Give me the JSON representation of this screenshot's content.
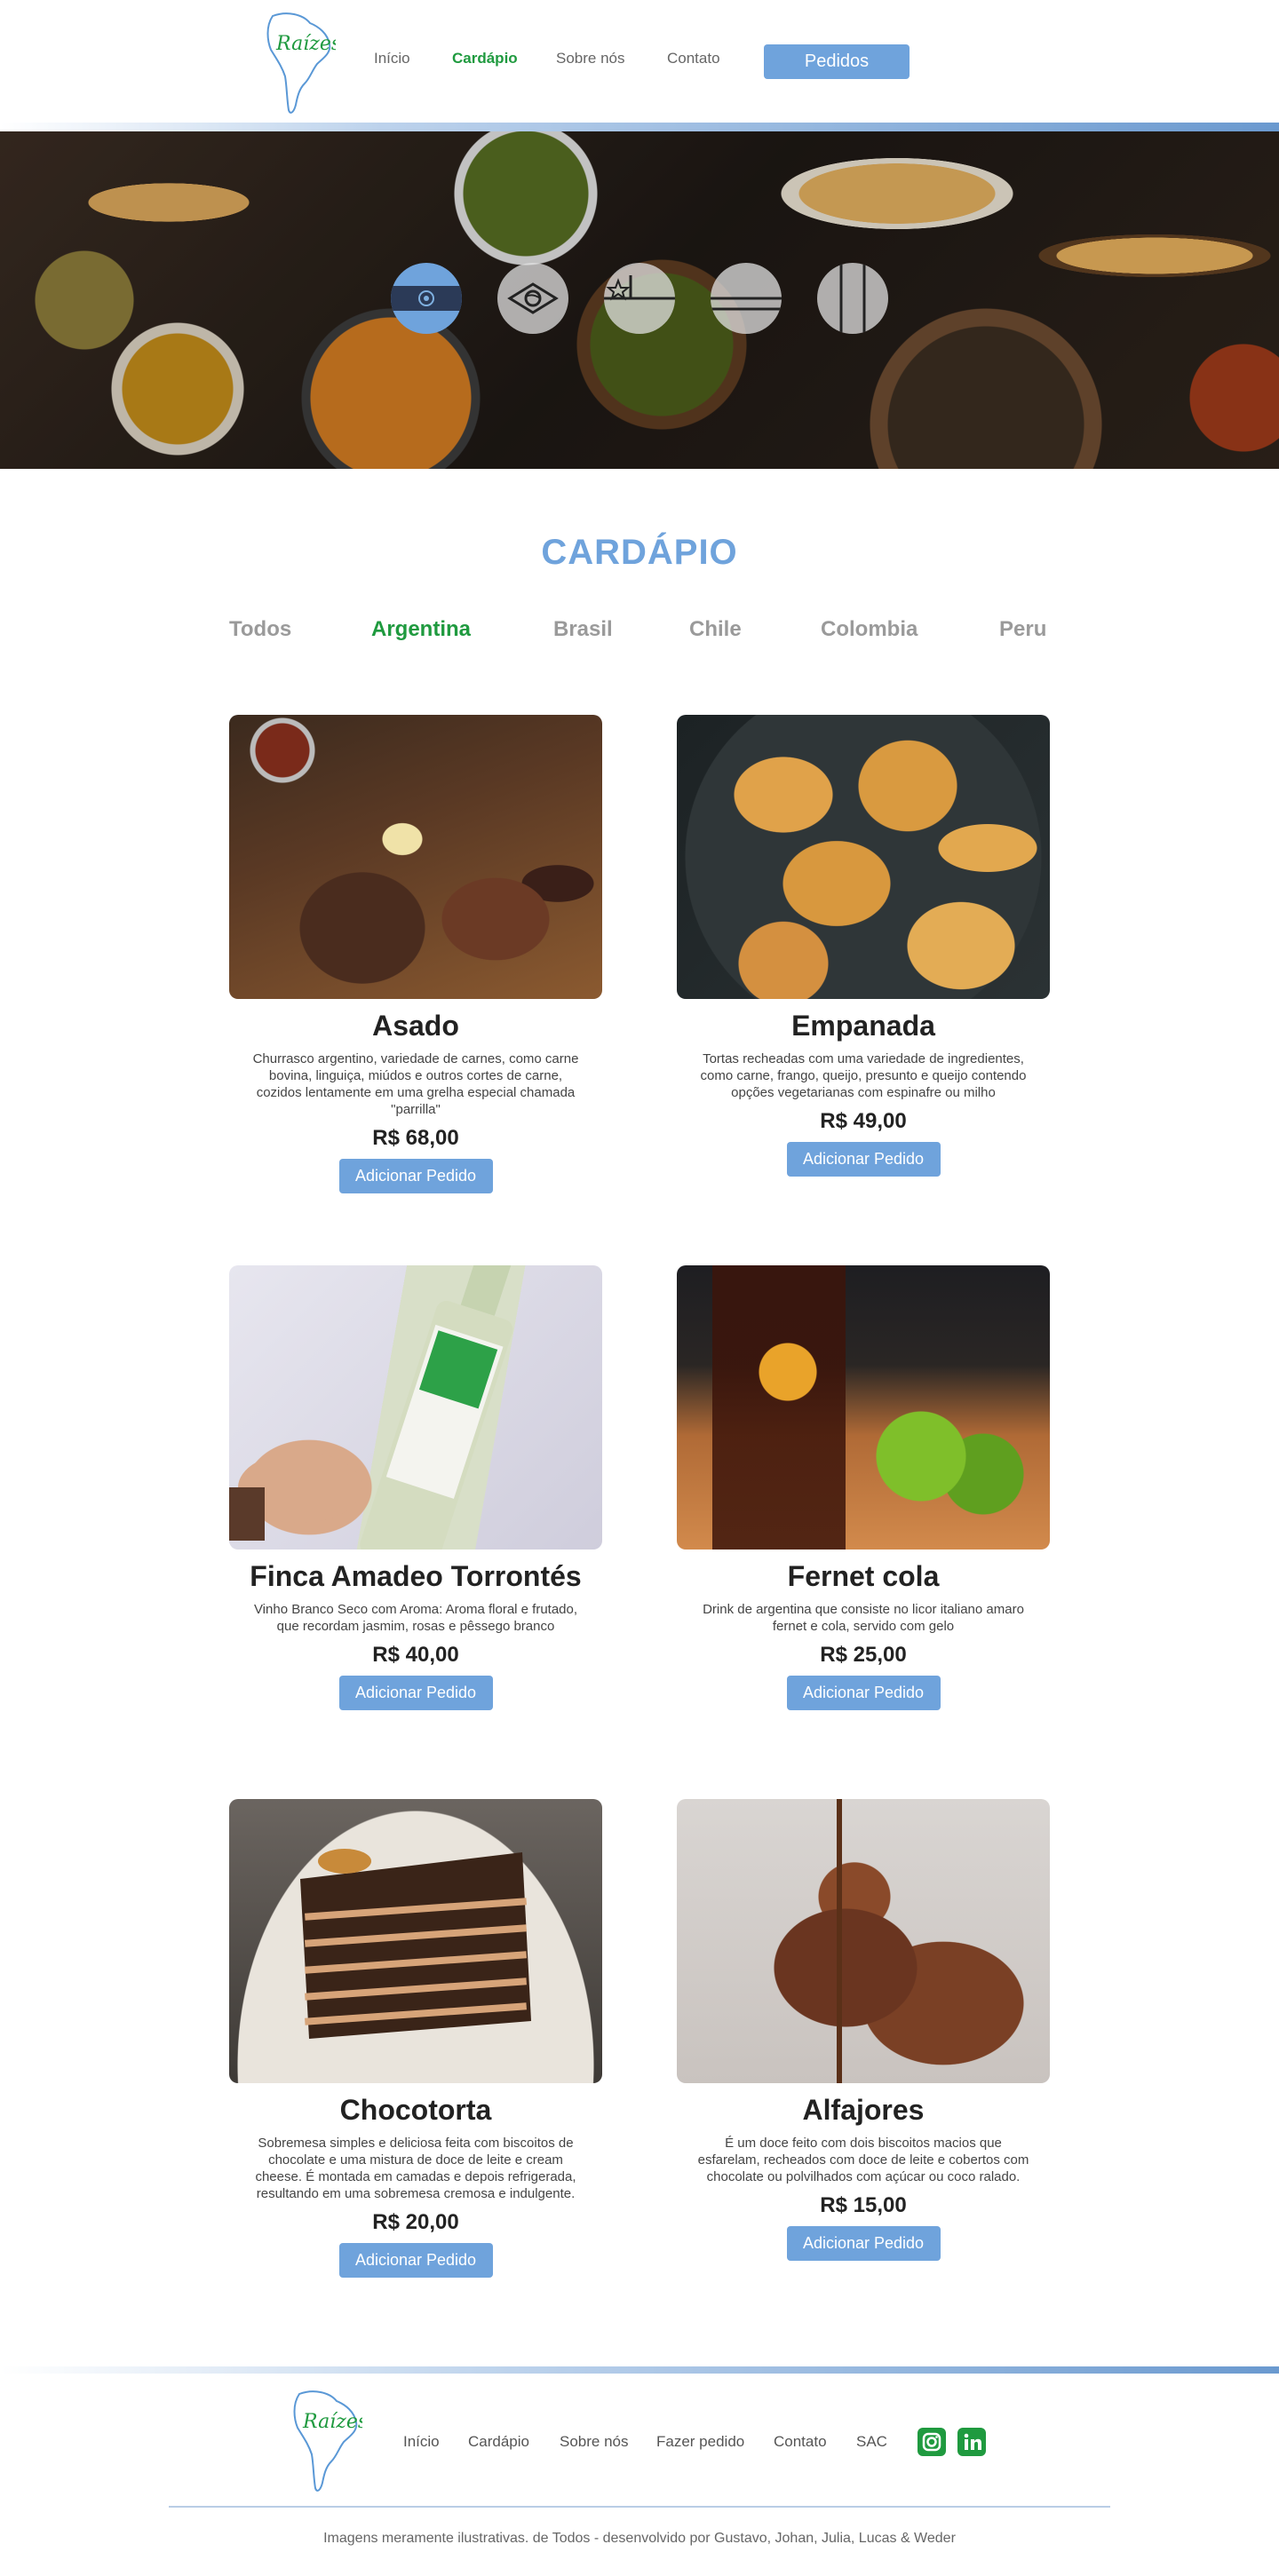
{
  "header": {
    "logo_text": "Raízes",
    "nav": [
      "Início",
      "Cardápio",
      "Sobre nós",
      "Contato"
    ],
    "active_nav": "Cardápio",
    "orders_label": "Pedidos"
  },
  "hero": {
    "flags": [
      "argentina",
      "brasil",
      "chile",
      "colombia",
      "peru"
    ],
    "active_flag": "argentina"
  },
  "menu": {
    "title": "CARDÁPIO",
    "tabs": [
      "Todos",
      "Argentina",
      "Brasil",
      "Chile",
      "Colombia",
      "Peru"
    ],
    "active_tab": "Argentina",
    "items": [
      {
        "name": "Asado",
        "description": "Churrasco argentino, variedade de carnes, como carne bovina, linguiça, miúdos e outros cortes de carne, cozidos lentamente em uma grelha especial chamada \"parrilla\"",
        "price": "R$ 68,00",
        "button": "Adicionar Pedido"
      },
      {
        "name": "Empanada",
        "description": "Tortas recheadas com uma variedade de ingredientes, como carne, frango, queijo, presunto e queijo contendo opções vegetarianas com espinafre ou milho",
        "price": "R$ 49,00",
        "button": "Adicionar Pedido"
      },
      {
        "name": "Finca Amadeo Torrontés",
        "description": "Vinho Branco Seco com Aroma: Aroma floral e frutado, que recordam jasmim, rosas e pêssego branco",
        "price": "R$ 40,00",
        "button": "Adicionar Pedido"
      },
      {
        "name": "Fernet cola",
        "description": "Drink de argentina que consiste no licor italiano amaro fernet e cola, servido com gelo",
        "price": "R$ 25,00",
        "button": "Adicionar Pedido"
      },
      {
        "name": "Chocotorta",
        "description": "Sobremesa simples e deliciosa feita com biscoitos de chocolate e uma mistura de doce de leite e cream cheese. É montada em camadas e depois refrigerada, resultando em uma sobremesa cremosa e indulgente.",
        "price": "R$ 20,00",
        "button": "Adicionar Pedido"
      },
      {
        "name": "Alfajores",
        "description": "É um doce feito com dois biscoitos macios que esfarelam, recheados com doce de leite e cobertos com chocolate ou polvilhados com açúcar ou coco ralado.",
        "price": "R$ 15,00",
        "button": "Adicionar Pedido"
      }
    ]
  },
  "footer": {
    "nav": [
      "Início",
      "Cardápio",
      "Sobre nós",
      "Fazer pedido",
      "Contato",
      "SAC"
    ],
    "social": [
      "instagram-icon",
      "linkedin-icon"
    ],
    "credits": "Imagens meramente ilustrativas. de Todos - desenvolvido por Gustavo, Johan, Julia, Lucas & Weder"
  },
  "colors": {
    "accent_blue": "#6fa3dc",
    "accent_green": "#1f9a3f"
  }
}
